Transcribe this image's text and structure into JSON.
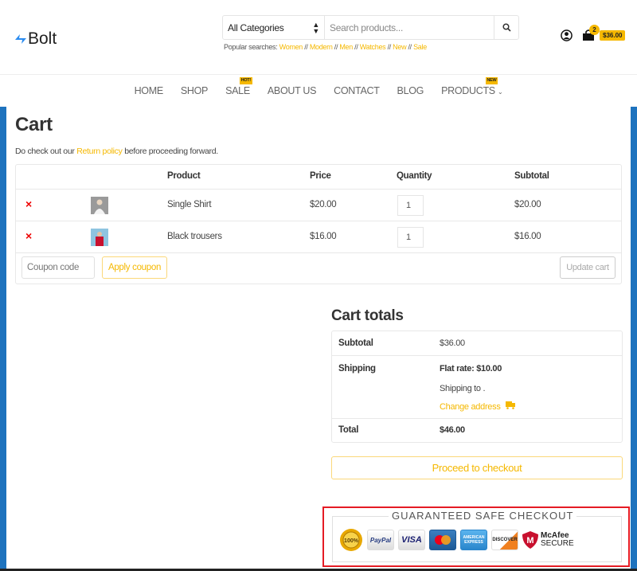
{
  "brand": {
    "name": "Bolt",
    "accent": "#f5b800",
    "link_color": "#f5b800",
    "rail_color": "#1e73be"
  },
  "search": {
    "category": "All Categories",
    "placeholder": "Search products...",
    "popular_label": "Popular searches:",
    "popular": [
      "Women",
      "Modern",
      "Men",
      "Watches",
      "New",
      "Sale"
    ],
    "separator": "//"
  },
  "header_cart": {
    "count": "2",
    "total": "$36.00"
  },
  "nav": [
    {
      "label": "HOME"
    },
    {
      "label": "SHOP"
    },
    {
      "label": "SALE",
      "badge": "HOT!"
    },
    {
      "label": "ABOUT US"
    },
    {
      "label": "CONTACT"
    },
    {
      "label": "BLOG"
    },
    {
      "label": "PRODUCTS",
      "badge": "NEW",
      "dropdown": true
    }
  ],
  "page": {
    "title": "Cart",
    "notice_before": "Do check out our ",
    "notice_link": "Return policy",
    "notice_after": " before proceeding forward."
  },
  "cart": {
    "headers": {
      "product": "Product",
      "price": "Price",
      "quantity": "Quantity",
      "subtotal": "Subtotal"
    },
    "items": [
      {
        "name": "Single Shirt",
        "price": "$20.00",
        "quantity": "1",
        "subtotal": "$20.00",
        "remove": "×"
      },
      {
        "name": "Black trousers",
        "price": "$16.00",
        "quantity": "1",
        "subtotal": "$16.00",
        "remove": "×"
      }
    ],
    "coupon_placeholder": "Coupon code",
    "apply_coupon": "Apply coupon",
    "update_cart": "Update cart"
  },
  "totals": {
    "title": "Cart totals",
    "subtotal_label": "Subtotal",
    "subtotal": "$36.00",
    "shipping_label": "Shipping",
    "shipping_method": "Flat rate: $10.00",
    "shipping_to": "Shipping to  .",
    "change_address": "Change address",
    "total_label": "Total",
    "total": "$46.00",
    "checkout": "Proceed to checkout"
  },
  "trust": {
    "title": "GUARANTEED SAFE CHECKOUT",
    "badges": [
      "100% Satisfaction Guarantee",
      "PayPal",
      "VISA",
      "MasterCard",
      "American Express",
      "DISCOVER",
      "McAfee SECURE"
    ]
  }
}
